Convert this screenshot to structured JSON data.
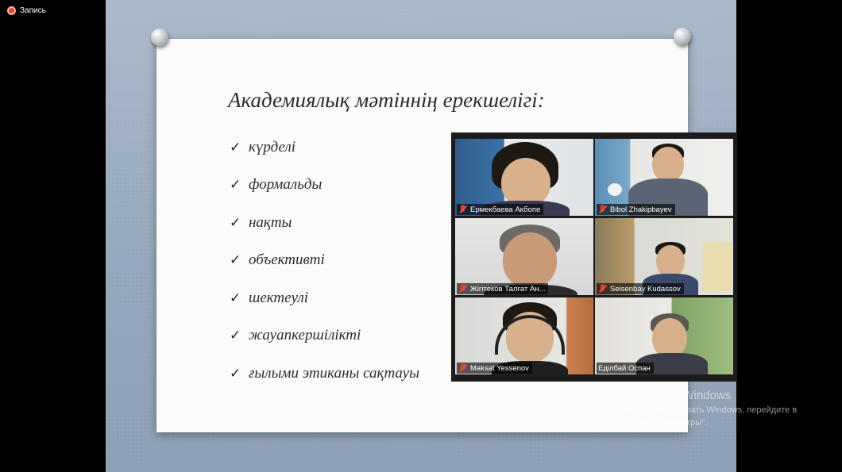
{
  "recording": {
    "label": "Запись"
  },
  "slide": {
    "title": "Академиялық мәтіннің ерекшелігі:",
    "check_glyph": "✓",
    "bullets": [
      "күрделі",
      "формальды",
      "нақты",
      "объективті",
      "шектеулі",
      "жауапкершілікті",
      "ғылыми этиканы сақтауы"
    ]
  },
  "participants": [
    {
      "name": "Ермекбаева Акбопе",
      "muted": true
    },
    {
      "name": "Bibol Zhakipbayev",
      "muted": true
    },
    {
      "name": "Жігітеков Талғат Ан...",
      "muted": true
    },
    {
      "name": "Seisenbay Kudassov",
      "muted": true
    },
    {
      "name": "Maksat Yessenov",
      "muted": true
    },
    {
      "name": "Еділбай Оспан",
      "muted": false,
      "active_speaker": true
    }
  ],
  "watermark": {
    "title": "Активация Windows",
    "line1": "Чтобы активировать Windows, перейдите в",
    "line2": "раздел \"Параметры\"."
  },
  "colors": {
    "recording_dot": "#e8442f",
    "active_speaker_border": "#c6d94a",
    "mic_muted": "#e03a2f"
  }
}
